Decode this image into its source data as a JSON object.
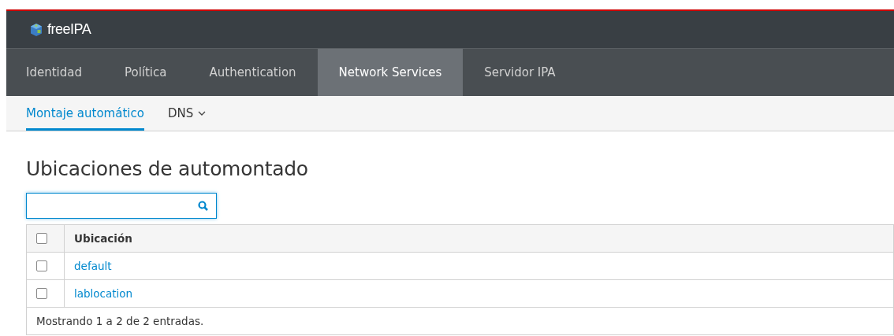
{
  "brand": "freeIPA",
  "nav": [
    {
      "label": "Identidad",
      "selected": false
    },
    {
      "label": "Política",
      "selected": false
    },
    {
      "label": "Authentication",
      "selected": false
    },
    {
      "label": "Network Services",
      "selected": true
    },
    {
      "label": "Servidor IPA",
      "selected": false
    }
  ],
  "subnav": [
    {
      "label": "Montaje automático",
      "selected": true,
      "dropdown": false
    },
    {
      "label": "DNS",
      "selected": false,
      "dropdown": true
    }
  ],
  "title": "Ubicaciones de automontado",
  "table": {
    "columns": [
      "Ubicación"
    ],
    "header_checked": false,
    "rows": [
      {
        "cell": "default",
        "checked": false
      },
      {
        "cell": "lablocation",
        "checked": false
      }
    ]
  },
  "footer": "Mostrando 1 a 2 de 2 entradas."
}
